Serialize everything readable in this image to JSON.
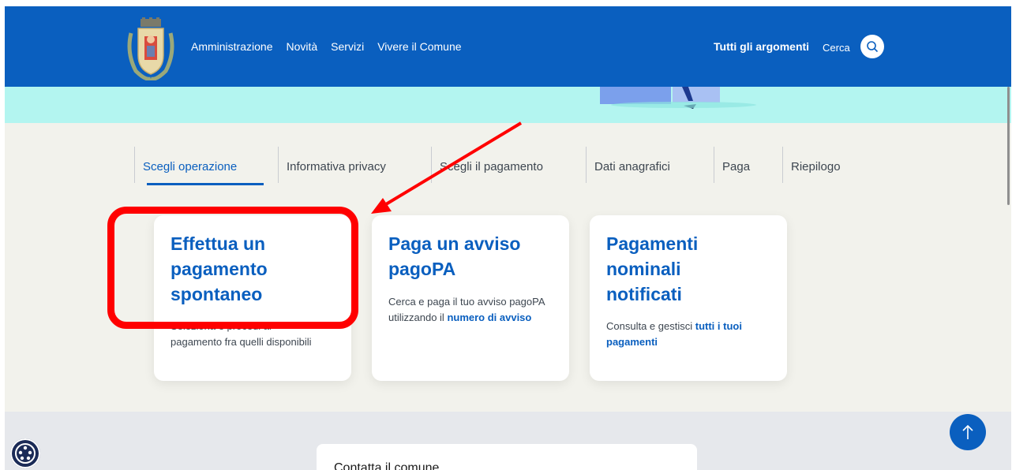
{
  "header": {
    "nav": [
      "Amministrazione",
      "Novità",
      "Servizi",
      "Vivere il Comune"
    ],
    "topics_label": "Tutti gli argomenti",
    "search_label": "Cerca"
  },
  "steps": [
    "Scegli operazione",
    "Informativa privacy",
    "Scegli il pagamento",
    "Dati anagrafici",
    "Paga",
    "Riepilogo"
  ],
  "cards": [
    {
      "title_lines": [
        "Effettua un",
        "pagamento",
        "spontaneo"
      ],
      "desc_line1": "Seleziona e procedi al",
      "desc_line2": "pagamento fra quelli disponibili"
    },
    {
      "title_lines": [
        "Paga un avviso",
        "pagoPA"
      ],
      "desc_line1": "Cerca e paga il tuo avviso pagoPA",
      "desc_pre": "utilizzando il ",
      "desc_bold": "numero di avviso"
    },
    {
      "title_lines": [
        "Pagamenti",
        "nominali",
        "notificati"
      ],
      "desc_pre": "Consulta e gestisci ",
      "desc_bold1": "tutti i tuoi",
      "desc_bold2": "pagamenti"
    }
  ],
  "contact": {
    "title": "Contatta il comune"
  },
  "colors": {
    "primary": "#0a5fbf",
    "highlight": "#ff0000",
    "hero": "#b3f5f0"
  },
  "icons": [
    "coat-of-arms-logo",
    "search-icon",
    "accessibility-icon",
    "arrow-up-icon"
  ]
}
